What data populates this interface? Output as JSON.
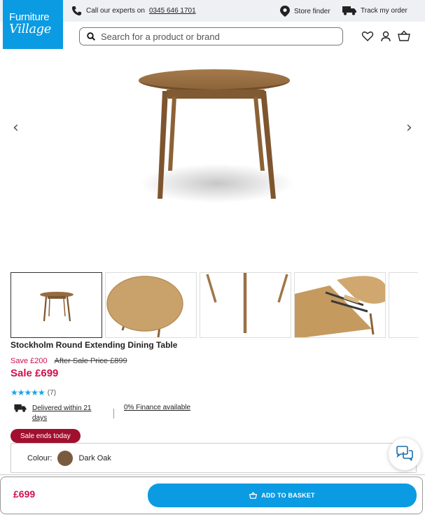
{
  "header": {
    "logo_line1": "Furniture",
    "logo_line2": "Village",
    "call_prefix": "Call our experts on",
    "call_number": "0345 646 1701",
    "store_finder": "Store finder",
    "track_order": "Track my order",
    "search_placeholder": "Search for a product or brand"
  },
  "gallery": {
    "prev_icon": "‹",
    "next_icon": "›"
  },
  "product": {
    "title": "Stockholm Round Extending Dining Table",
    "save_text": "Save £200",
    "was_price": "After Sale Price £899",
    "sale_price": "Sale £699",
    "stars": "★★★★★",
    "review_count": "(7)",
    "delivery": "Delivered within 21 days",
    "finance": "0% Finance available",
    "sale_badge": "Sale ends today",
    "colour_label": "Colour:",
    "colour_value": "Dark Oak",
    "colour_hex": "#7a5a3e"
  },
  "footer": {
    "price": "£699",
    "add_to_basket": "ADD TO BASKET"
  },
  "colors": {
    "brand_blue": "#0a9be3",
    "sale_red": "#d0104c",
    "badge_red": "#a0102e",
    "star_blue": "#1aa3e8"
  }
}
